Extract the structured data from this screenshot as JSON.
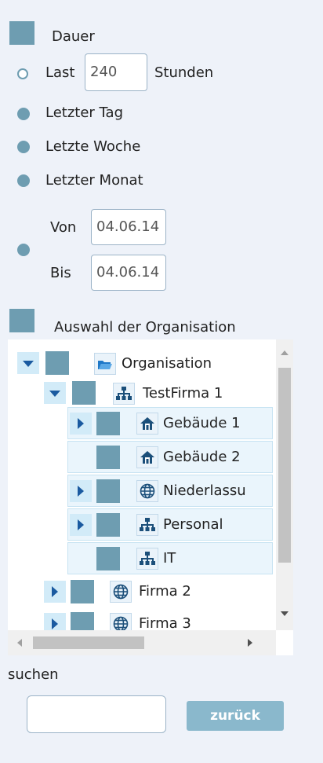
{
  "duration": {
    "title": "Dauer",
    "last_label": "Last",
    "last_value": "240",
    "hours_label": "Stunden",
    "options": [
      "Letzter Tag",
      "Letzte Woche",
      "Letzter Monat"
    ],
    "from_label": "Von",
    "from_value": "04.06.14",
    "to_label": "Bis",
    "to_value": "04.06.14"
  },
  "org": {
    "title": "Auswahl der Organisation",
    "tree": [
      {
        "label": "Organisation",
        "icon": "folder-open-icon"
      },
      {
        "label": "TestFirma 1",
        "icon": "org-chart-icon"
      },
      {
        "label": "Gebäude 1",
        "icon": "house-icon"
      },
      {
        "label": "Gebäude 2",
        "icon": "house-icon"
      },
      {
        "label": "Niederlassu",
        "icon": "globe-icon"
      },
      {
        "label": "Personal",
        "icon": "org-chart-icon"
      },
      {
        "label": "IT",
        "icon": "org-chart-icon"
      },
      {
        "label": "Firma 2",
        "icon": "globe-icon"
      },
      {
        "label": "Firma 3",
        "icon": "globe-icon"
      }
    ]
  },
  "search": {
    "label": "suchen",
    "value": "",
    "back_label": "zurück"
  },
  "colors": {
    "accent": "#6e9db1",
    "button": "#8ab8cc",
    "background": "#eef2f9"
  }
}
